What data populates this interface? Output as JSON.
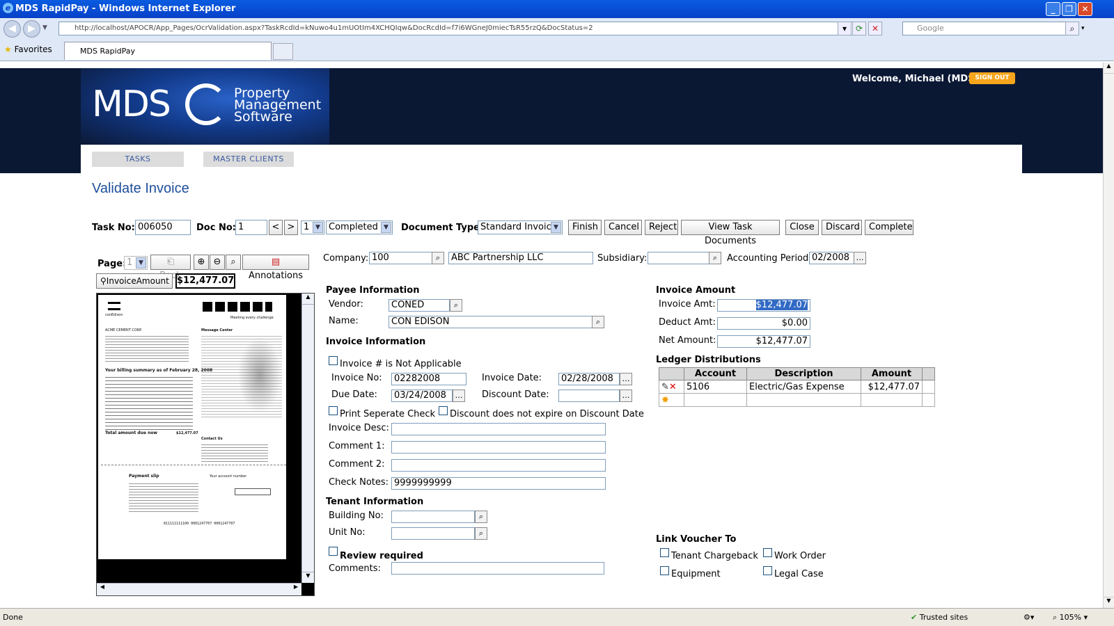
{
  "window": {
    "title": "MDS RapidPay - Windows Internet Explorer"
  },
  "browser": {
    "url": "http://localhost/APOCR/App_Pages/OcrValidation.aspx?TaskRcdId=kNuwo4u1mUOtIm4XCHQIqw&DocRcdId=f7i6WGneJ0miecTsR55rzQ&DocStatus=2",
    "search_placeholder": "Google",
    "favorites_label": "Favorites",
    "tab_label": "MDS RapidPay"
  },
  "header": {
    "logo_mds": "MDS",
    "logo_line1": "Property",
    "logo_line2": "Management",
    "logo_line3": "Software",
    "welcome": "Welcome, Michael (MDS)",
    "signout": "SIGN OUT"
  },
  "nav": {
    "tasks": "TASKS",
    "master_clients": "MASTER CLIENTS"
  },
  "page": {
    "title": "Validate Invoice"
  },
  "toolbar": {
    "task_no_label": "Task No:",
    "task_no": "006050",
    "doc_no_label": "Doc No:",
    "doc_no": "1",
    "prev": "<",
    "next": ">",
    "doc_select": "1",
    "status_select": "Completed",
    "doc_type_label": "Document Type:",
    "doc_type": "Standard Invoice",
    "buttons": [
      "Finish",
      "Cancel",
      "Reject",
      "View Task Documents",
      "Close",
      "Discard",
      "Complete"
    ]
  },
  "viewer": {
    "page_label": "Page:",
    "page_value": "1",
    "back": "Back",
    "annotations": "Annotations",
    "field_label": "InvoiceAmount",
    "field_value": "$12,477.07",
    "doc": {
      "brand": "conEdison",
      "tagline": "Meeting every challenge",
      "company": "ACME CEMENT CORP",
      "summary": "Your billing summary as of February 28, 2008",
      "total_due": "Total amount due now",
      "amount": "$12,477.07",
      "message_center": "Message Center",
      "contact_us": "Contact Us",
      "payment_slip": "Payment slip",
      "account_line": "Your account number",
      "micr": "811111111100  0001247707  0001247707"
    }
  },
  "company": {
    "company_label": "Company:",
    "company_code": "100",
    "company_name": "ABC Partnership LLC",
    "subsidiary_label": "Subsidiary:",
    "subsidiary": "",
    "period_label": "Accounting Period:",
    "period": "02/2008"
  },
  "payee": {
    "section": "Payee Information",
    "vendor_label": "Vendor:",
    "vendor": "CONED",
    "name_label": "Name:",
    "name": "CON EDISON"
  },
  "invoice": {
    "section": "Invoice Information",
    "not_applicable": "Invoice # is Not Applicable",
    "invoice_no_label": "Invoice No:",
    "invoice_no": "02282008",
    "invoice_date_label": "Invoice Date:",
    "invoice_date": "02/28/2008",
    "due_date_label": "Due Date:",
    "due_date": "03/24/2008",
    "discount_date_label": "Discount Date:",
    "discount_date": "",
    "print_separate": "Print Seperate Check",
    "discount_no_expire": "Discount does not expire on Discount Date",
    "desc_label": "Invoice Desc:",
    "desc": "",
    "comment1_label": "Comment 1:",
    "comment1": "",
    "comment2_label": "Comment 2:",
    "comment2": "",
    "check_notes_label": "Check Notes:",
    "check_notes": "9999999999"
  },
  "tenant": {
    "section": "Tenant Information",
    "building_label": "Building No:",
    "building": "",
    "unit_label": "Unit No:",
    "unit": "",
    "review_required": "Review required",
    "comments_label": "Comments:",
    "comments": ""
  },
  "amounts": {
    "section": "Invoice Amount",
    "invoice_amt_label": "Invoice Amt:",
    "invoice_amt": "$12,477.07",
    "deduct_amt_label": "Deduct Amt:",
    "deduct_amt": "$0.00",
    "net_amt_label": "Net Amount:",
    "net_amt": "$12,477.07"
  },
  "ledger": {
    "section": "Ledger Distributions",
    "headers": [
      "Account",
      "Description",
      "Amount"
    ],
    "rows": [
      {
        "account": "5106",
        "description": "Electric/Gas Expense",
        "amount": "$12,477.07"
      }
    ]
  },
  "link_voucher": {
    "section": "Link Voucher To",
    "tenant_chargeback": "Tenant Chargeback",
    "work_order": "Work Order",
    "equipment": "Equipment",
    "legal_case": "Legal Case"
  },
  "statusbar": {
    "status": "Done",
    "zone": "Trusted sites",
    "zoom": "105%"
  },
  "colors": {
    "accent": "#1d4e9a",
    "header_bg": "#0b1834",
    "signout": "#f7a51c",
    "titlebar": "#0a5ce0"
  }
}
